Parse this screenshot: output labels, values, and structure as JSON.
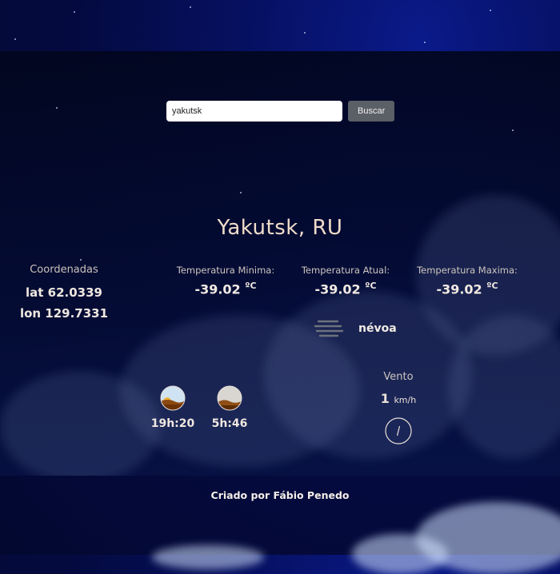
{
  "search": {
    "value": "yakutsk",
    "button_label": "Buscar"
  },
  "location": {
    "name": "Yakutsk, RU"
  },
  "coordinates": {
    "label": "Coordenadas",
    "lat": "lat 62.0339",
    "lon": "lon 129.7331"
  },
  "temperatures": {
    "min": {
      "label": "Temperatura Minima:",
      "value": "-39.02",
      "unit": "ºC"
    },
    "current": {
      "label": "Temperatura Atual:",
      "value": "-39.02",
      "unit": "ºC"
    },
    "max": {
      "label": "Temperatura Maxima:",
      "value": "-39.02",
      "unit": "ºC"
    }
  },
  "weather": {
    "description": "névoa",
    "icon": "mist-icon"
  },
  "sun": {
    "sunset": {
      "time": "19h:20",
      "icon": "sunset-icon"
    },
    "sunrise": {
      "time": "5h:46",
      "icon": "sunrise-icon"
    }
  },
  "wind": {
    "label": "Vento",
    "speed": "1",
    "unit": "km/h",
    "icon": "wind-direction-icon"
  },
  "footer": {
    "credit": "Criado por Fábio Penedo"
  },
  "colors": {
    "panel": "#030a2d",
    "title": "#f0dcc9",
    "button": "#5b5f66"
  }
}
